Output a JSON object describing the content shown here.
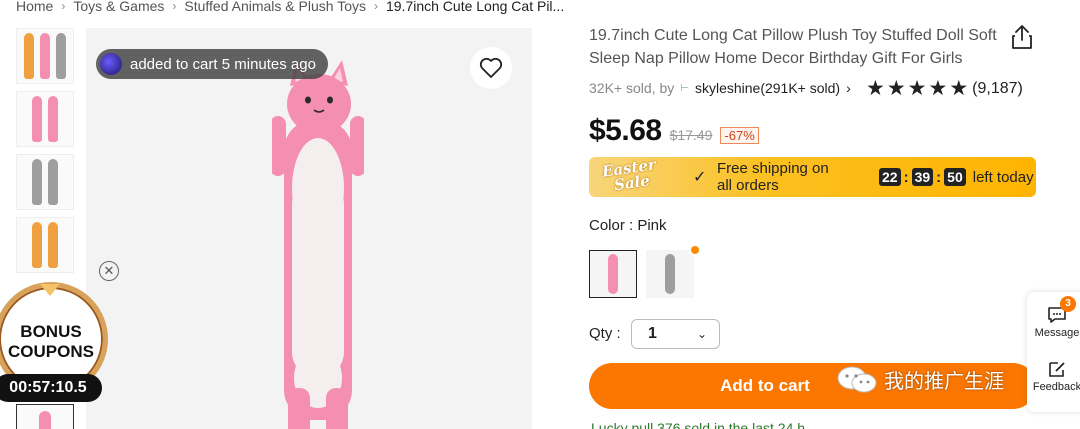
{
  "breadcrumb": {
    "items": [
      "Home",
      "Toys & Games",
      "Stuffed Animals & Plush Toys"
    ],
    "current": "19.7inch Cute Long Cat Pil..."
  },
  "gallery": {
    "cart_toast": "added to cart 5 minutes ago",
    "bonus": {
      "line1": "BONUS",
      "line2": "COUPONS",
      "timer": "00:57:10.5"
    }
  },
  "product": {
    "title": "19.7inch Cute Long Cat Pillow Plush Toy Stuffed Doll Soft Sleep Nap Pillow Home Decor Birthday Gift For Girls",
    "sold": "32K+ sold, by",
    "store": "skyleshine(291K+ sold)",
    "rating_count": "(9,187)",
    "rating_value": 5,
    "price": "$5.68",
    "original_price": "$17.49",
    "discount": "-67%"
  },
  "promo": {
    "sale_line1": "Easter",
    "sale_line2": "Sale",
    "shipping_line1": "Free shipping on",
    "shipping_line2": "all orders",
    "timer": {
      "h": "22",
      "m": "39",
      "s": "50"
    },
    "left_label": "left today"
  },
  "options": {
    "color_label": "Color : Pink",
    "qty_label": "Qty :",
    "qty_value": "1"
  },
  "actions": {
    "add_to_cart": "Add to cart"
  },
  "watermark": "我的推广生涯",
  "bottom_text": "Lucky pull 376 sold in the last 24 h",
  "side_panel": {
    "message_label": "Message",
    "message_badge": "3",
    "feedback_label": "Feedback"
  },
  "colors": {
    "accent": "#fb7701",
    "promo_bg": "#fbc021",
    "pink": "#f48fb1",
    "gray": "#9e9e9e",
    "orange": "#f0a040"
  }
}
